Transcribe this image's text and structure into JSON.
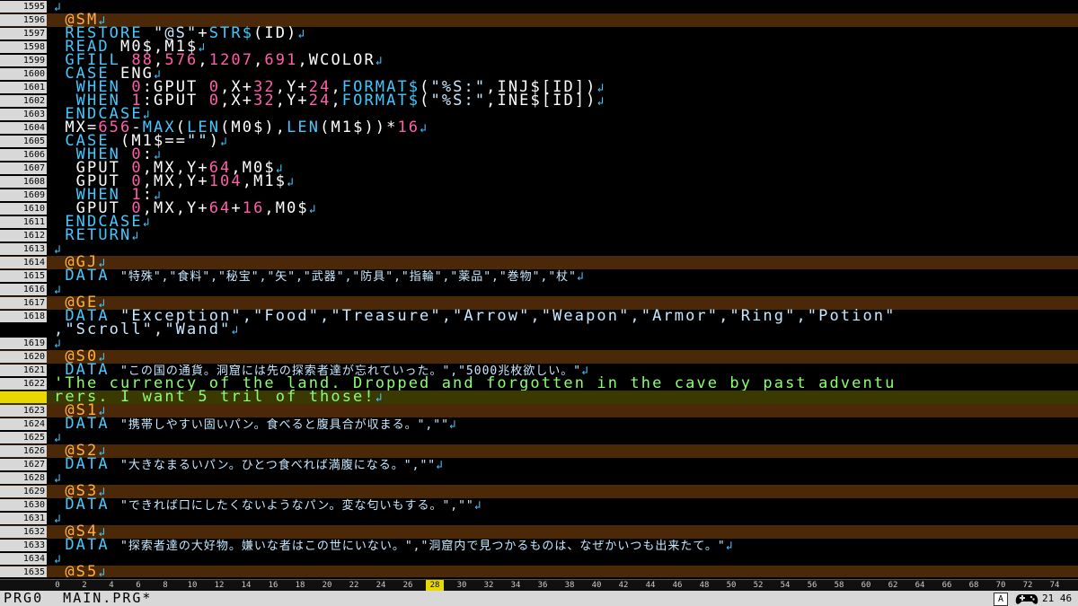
{
  "editor": {
    "lines": [
      {
        "num": "1595",
        "type": "normal",
        "tokens": [
          {
            "t": "",
            "c": "plain"
          }
        ]
      },
      {
        "num": "1596",
        "type": "label",
        "tokens": [
          {
            "t": " @SM",
            "c": "lbl"
          }
        ]
      },
      {
        "num": "1597",
        "type": "normal",
        "tokens": [
          {
            "t": " RESTORE ",
            "c": "kw"
          },
          {
            "t": "\"@S\"",
            "c": "str"
          },
          {
            "t": "+",
            "c": "plain"
          },
          {
            "t": "STR$",
            "c": "kw"
          },
          {
            "t": "(ID)",
            "c": "plain"
          }
        ]
      },
      {
        "num": "1598",
        "type": "normal",
        "tokens": [
          {
            "t": " READ ",
            "c": "kw"
          },
          {
            "t": "M0$,M1$",
            "c": "plain"
          }
        ]
      },
      {
        "num": "1599",
        "type": "normal",
        "tokens": [
          {
            "t": " GFILL ",
            "c": "kw"
          },
          {
            "t": "88",
            "c": "num"
          },
          {
            "t": ",",
            "c": "plain"
          },
          {
            "t": "576",
            "c": "num"
          },
          {
            "t": ",",
            "c": "plain"
          },
          {
            "t": "1207",
            "c": "num"
          },
          {
            "t": ",",
            "c": "plain"
          },
          {
            "t": "691",
            "c": "num"
          },
          {
            "t": ",WCOLOR",
            "c": "plain"
          }
        ]
      },
      {
        "num": "1600",
        "type": "normal",
        "tokens": [
          {
            "t": " CASE ",
            "c": "kw"
          },
          {
            "t": "ENG",
            "c": "plain"
          }
        ]
      },
      {
        "num": "1601",
        "type": "normal",
        "tokens": [
          {
            "t": "  WHEN ",
            "c": "kw"
          },
          {
            "t": "0",
            "c": "num"
          },
          {
            "t": ":GPUT ",
            "c": "plain"
          },
          {
            "t": "0",
            "c": "num"
          },
          {
            "t": ",X+",
            "c": "plain"
          },
          {
            "t": "32",
            "c": "num"
          },
          {
            "t": ",Y+",
            "c": "plain"
          },
          {
            "t": "24",
            "c": "num"
          },
          {
            "t": ",",
            "c": "plain"
          },
          {
            "t": "FORMAT$",
            "c": "kw"
          },
          {
            "t": "(",
            "c": "plain"
          },
          {
            "t": "\"%S:\"",
            "c": "str"
          },
          {
            "t": ",INJ$[ID])",
            "c": "plain"
          }
        ]
      },
      {
        "num": "1602",
        "type": "normal",
        "tokens": [
          {
            "t": "  WHEN ",
            "c": "kw"
          },
          {
            "t": "1",
            "c": "num"
          },
          {
            "t": ":GPUT ",
            "c": "plain"
          },
          {
            "t": "0",
            "c": "num"
          },
          {
            "t": ",X+",
            "c": "plain"
          },
          {
            "t": "32",
            "c": "num"
          },
          {
            "t": ",Y+",
            "c": "plain"
          },
          {
            "t": "24",
            "c": "num"
          },
          {
            "t": ",",
            "c": "plain"
          },
          {
            "t": "FORMAT$",
            "c": "kw"
          },
          {
            "t": "(",
            "c": "plain"
          },
          {
            "t": "\"%S:\"",
            "c": "str"
          },
          {
            "t": ",INE$[ID])",
            "c": "plain"
          }
        ]
      },
      {
        "num": "1603",
        "type": "normal",
        "tokens": [
          {
            "t": " ENDCASE",
            "c": "kw"
          }
        ]
      },
      {
        "num": "1604",
        "type": "normal",
        "tokens": [
          {
            "t": " MX=",
            "c": "plain"
          },
          {
            "t": "656",
            "c": "num"
          },
          {
            "t": "-",
            "c": "plain"
          },
          {
            "t": "MAX",
            "c": "kw"
          },
          {
            "t": "(",
            "c": "plain"
          },
          {
            "t": "LEN",
            "c": "kw"
          },
          {
            "t": "(M0$),",
            "c": "plain"
          },
          {
            "t": "LEN",
            "c": "kw"
          },
          {
            "t": "(M1$))*",
            "c": "plain"
          },
          {
            "t": "16",
            "c": "num"
          }
        ]
      },
      {
        "num": "1605",
        "type": "normal",
        "tokens": [
          {
            "t": " CASE ",
            "c": "kw"
          },
          {
            "t": "(M1$==",
            "c": "plain"
          },
          {
            "t": "\"\"",
            "c": "str"
          },
          {
            "t": ")",
            "c": "plain"
          }
        ]
      },
      {
        "num": "1606",
        "type": "normal",
        "tokens": [
          {
            "t": "  WHEN ",
            "c": "kw"
          },
          {
            "t": "0",
            "c": "num"
          },
          {
            "t": ":",
            "c": "plain"
          }
        ]
      },
      {
        "num": "1607",
        "type": "normal",
        "tokens": [
          {
            "t": "  GPUT ",
            "c": "plain"
          },
          {
            "t": "0",
            "c": "num"
          },
          {
            "t": ",MX,Y+",
            "c": "plain"
          },
          {
            "t": "64",
            "c": "num"
          },
          {
            "t": ",M0$",
            "c": "plain"
          }
        ]
      },
      {
        "num": "1608",
        "type": "normal",
        "tokens": [
          {
            "t": "  GPUT ",
            "c": "plain"
          },
          {
            "t": "0",
            "c": "num"
          },
          {
            "t": ",MX,Y+",
            "c": "plain"
          },
          {
            "t": "104",
            "c": "num"
          },
          {
            "t": ",M1$",
            "c": "plain"
          }
        ]
      },
      {
        "num": "1609",
        "type": "normal",
        "tokens": [
          {
            "t": "  WHEN ",
            "c": "kw"
          },
          {
            "t": "1",
            "c": "num"
          },
          {
            "t": ":",
            "c": "plain"
          }
        ]
      },
      {
        "num": "1610",
        "type": "normal",
        "tokens": [
          {
            "t": "  GPUT ",
            "c": "plain"
          },
          {
            "t": "0",
            "c": "num"
          },
          {
            "t": ",MX,Y+",
            "c": "plain"
          },
          {
            "t": "64",
            "c": "num"
          },
          {
            "t": "+",
            "c": "plain"
          },
          {
            "t": "16",
            "c": "num"
          },
          {
            "t": ",M0$",
            "c": "plain"
          }
        ]
      },
      {
        "num": "1611",
        "type": "normal",
        "tokens": [
          {
            "t": " ENDCASE",
            "c": "kw"
          }
        ]
      },
      {
        "num": "1612",
        "type": "normal",
        "tokens": [
          {
            "t": " RETURN",
            "c": "kw"
          }
        ]
      },
      {
        "num": "1613",
        "type": "normal",
        "tokens": [
          {
            "t": "",
            "c": "plain"
          }
        ]
      },
      {
        "num": "1614",
        "type": "label",
        "tokens": [
          {
            "t": " @GJ",
            "c": "lbl"
          }
        ]
      },
      {
        "num": "1615",
        "type": "normal",
        "tokens": [
          {
            "t": " DATA ",
            "c": "kw"
          },
          {
            "t": "\"特殊\",\"食料\",\"秘宝\",\"矢\",\"武器\",\"防具\",\"指輪\",\"薬品\",\"巻物\",\"杖\"",
            "c": "str jp"
          }
        ]
      },
      {
        "num": "1616",
        "type": "normal",
        "tokens": [
          {
            "t": "",
            "c": "plain"
          }
        ]
      },
      {
        "num": "1617",
        "type": "label",
        "tokens": [
          {
            "t": " @GE",
            "c": "lbl"
          }
        ]
      },
      {
        "num": "1618",
        "type": "normal",
        "tokens": [
          {
            "t": " DATA ",
            "c": "kw"
          },
          {
            "t": "\"Exception\",\"Food\",\"Treasure\",\"Arrow\",\"Weapon\",\"Armor\",\"Ring\",\"Potion\"",
            "c": "str"
          }
        ],
        "noNl": true
      },
      {
        "num": "",
        "type": "wrapped",
        "tokens": [
          {
            "t": ",\"Scroll\",\"Wand\"",
            "c": "str"
          }
        ]
      },
      {
        "num": "1619",
        "type": "normal",
        "tokens": [
          {
            "t": "",
            "c": "plain"
          }
        ]
      },
      {
        "num": "1620",
        "type": "label",
        "tokens": [
          {
            "t": " @S0",
            "c": "lbl"
          }
        ]
      },
      {
        "num": "1621",
        "type": "normal",
        "tokens": [
          {
            "t": " DATA ",
            "c": "kw"
          },
          {
            "t": "\"この国の通貨。洞窟には先の探索者達が忘れていった。\",\"5000兆枚欲しい。\"",
            "c": "str jp"
          }
        ]
      },
      {
        "num": "1622",
        "type": "normal",
        "tokens": [
          {
            "t": "'The currency of the land. Dropped and forgotten in the cave by past adventu",
            "c": "cmt"
          }
        ],
        "noNl": true
      },
      {
        "num": "",
        "type": "cursor",
        "tokens": [
          {
            "t": "rers. I want 5 tril of those!",
            "c": "cmt"
          }
        ]
      },
      {
        "num": "1623",
        "type": "label",
        "tokens": [
          {
            "t": " @S1",
            "c": "lbl"
          }
        ]
      },
      {
        "num": "1624",
        "type": "normal",
        "tokens": [
          {
            "t": " DATA ",
            "c": "kw"
          },
          {
            "t": "\"携帯しやすい固いパン。食べると腹具合が収まる。\",\"\"",
            "c": "str jp"
          }
        ]
      },
      {
        "num": "1625",
        "type": "normal",
        "tokens": [
          {
            "t": "",
            "c": "plain"
          }
        ]
      },
      {
        "num": "1626",
        "type": "label",
        "tokens": [
          {
            "t": " @S2",
            "c": "lbl"
          }
        ]
      },
      {
        "num": "1627",
        "type": "normal",
        "tokens": [
          {
            "t": " DATA ",
            "c": "kw"
          },
          {
            "t": "\"大きなまるいパン。ひとつ食べれば満腹になる。\",\"\"",
            "c": "str jp"
          }
        ]
      },
      {
        "num": "1628",
        "type": "normal",
        "tokens": [
          {
            "t": "",
            "c": "plain"
          }
        ]
      },
      {
        "num": "1629",
        "type": "label",
        "tokens": [
          {
            "t": " @S3",
            "c": "lbl"
          }
        ]
      },
      {
        "num": "1630",
        "type": "normal",
        "tokens": [
          {
            "t": " DATA ",
            "c": "kw"
          },
          {
            "t": "\"できれば口にしたくないようなパン。変な匂いもする。\",\"\"",
            "c": "str jp"
          }
        ]
      },
      {
        "num": "1631",
        "type": "normal",
        "tokens": [
          {
            "t": "",
            "c": "plain"
          }
        ]
      },
      {
        "num": "1632",
        "type": "label",
        "tokens": [
          {
            "t": " @S4",
            "c": "lbl"
          }
        ]
      },
      {
        "num": "1633",
        "type": "normal",
        "tokens": [
          {
            "t": " DATA ",
            "c": "kw"
          },
          {
            "t": "\"探索者達の大好物。嫌いな者はこの世にいない。\",\"洞窟内で見つかるものは、なぜかいつも出来たて。\"",
            "c": "str jp"
          }
        ]
      },
      {
        "num": "1634",
        "type": "normal",
        "tokens": [
          {
            "t": "",
            "c": "plain"
          }
        ]
      },
      {
        "num": "1635",
        "type": "label",
        "tokens": [
          {
            "t": " @S5",
            "c": "lbl"
          }
        ]
      }
    ]
  },
  "ruler": {
    "ticks": [
      "0",
      "2",
      "4",
      "6",
      "8",
      "10",
      "12",
      "14",
      "16",
      "18",
      "20",
      "22",
      "24",
      "26",
      "28",
      "30",
      "32",
      "34",
      "36",
      "38",
      "40",
      "42",
      "44",
      "46",
      "48",
      "50",
      "52",
      "54",
      "56",
      "58",
      "60",
      "62",
      "64",
      "66",
      "68",
      "70",
      "72",
      "74"
    ],
    "highlight": "28"
  },
  "status": {
    "file_label": "PRG0  MAIN.PRG*",
    "mode": "A",
    "position": "21 46",
    "icon": "gamepad-icon"
  },
  "colors": {
    "label_row": "#4a2808",
    "cursor_row": "#3a3a00",
    "keyword": "#44c8ff",
    "label": "#ffb040",
    "number": "#ff5fa8",
    "comment": "#8cff6e"
  }
}
